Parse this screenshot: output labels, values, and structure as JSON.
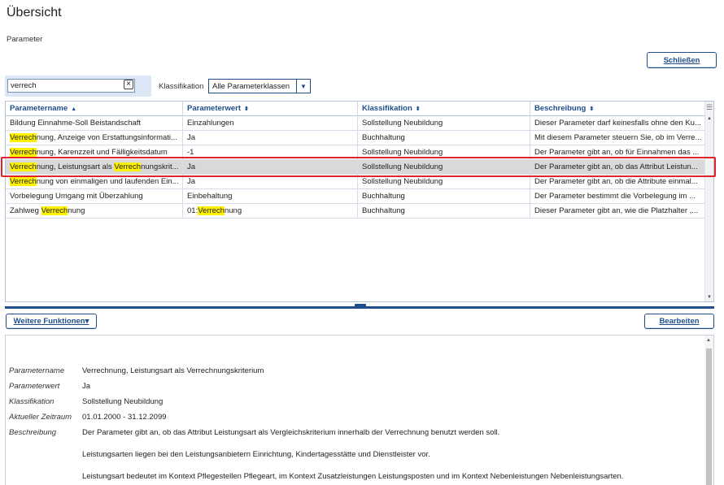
{
  "page": {
    "title": "Übersicht",
    "section_label": "Parameter"
  },
  "toolbar": {
    "close_label": "Schließen"
  },
  "filter": {
    "search_value": "verrech",
    "classification_label": "Klassifikation",
    "classification_value": "Alle Parameterklassen"
  },
  "grid": {
    "columns": [
      "Parametername",
      "Parameterwert",
      "Klassifikation",
      "Beschreibung"
    ],
    "rows": [
      {
        "name": "Bildung Einnahme-Soll Beistandschaft",
        "value": "Einzahlungen",
        "classification": "Sollstellung Neubildung",
        "description": "Dieser Parameter darf keinesfalls ohne den Ku..."
      },
      {
        "name": "Verrechnung, Anzeige von Erstattungsinformati...",
        "value": "Ja",
        "classification": "Buchhaltung",
        "description": "Mit diesem Parameter steuern Sie, ob im Verre..."
      },
      {
        "name": "Verrechnung, Karenzzeit und Fälligkeitsdatum",
        "value": "-1",
        "classification": "Sollstellung Neubildung",
        "description": "Der Parameter gibt an, ob für Einnahmen das ..."
      },
      {
        "name": "Verrechnung, Leistungsart als Verrechnungskrit...",
        "value": "Ja",
        "classification": "Sollstellung Neubildung",
        "description": "Der Parameter gibt an, ob das Attribut Leistun..."
      },
      {
        "name": "Verrechnung von einmaligen und laufenden Ein...",
        "value": "Ja",
        "classification": "Sollstellung Neubildung",
        "description": "Der Parameter gibt an, ob die Attribute einmal..."
      },
      {
        "name": "Vorbelegung Umgang mit Überzahlung",
        "value": "Einbehaltung",
        "classification": "Buchhaltung",
        "description": "Der Parameter bestimmt die Vorbelegung im ..."
      },
      {
        "name": "Zahlweg Verrechnung",
        "value": "01:Verrechnung",
        "classification": "Buchhaltung",
        "description": "Dieser Parameter gibt an, wie die Platzhalter ,..."
      }
    ],
    "selected_row": 3,
    "highlight_term": "Verrech"
  },
  "actions": {
    "more_label": "Weitere Funktionen▾",
    "edit_label": "Bearbeiten"
  },
  "detail": {
    "fields": [
      {
        "label": "Parametername",
        "value": "Verrechnung, Leistungsart als Verrechnungskriterium"
      },
      {
        "label": "Parameterwert",
        "value": "Ja"
      },
      {
        "label": "Klassifikation",
        "value": "Sollstellung Neubildung"
      },
      {
        "label": "Aktueller Zeitraum",
        "value": "01.01.2000 - 31.12.2099"
      },
      {
        "label": "Beschreibung",
        "value": "Der Parameter gibt an, ob das Attribut Leistungsart als Vergleichskriterium innerhalb der Verrechnung benutzt werden soll."
      }
    ],
    "paragraphs": [
      "Leistungsarten liegen bei den Leistungsanbietern Einrichtung, Kindertagesstätte und Dienstleister vor.",
      "Leistungsart bedeutet im Kontext Pflegestellen Pflegeart, im Kontext Zusatzleistungen Leistungsposten und im Kontext Nebenleistungen Nebenleistungsarten."
    ]
  }
}
